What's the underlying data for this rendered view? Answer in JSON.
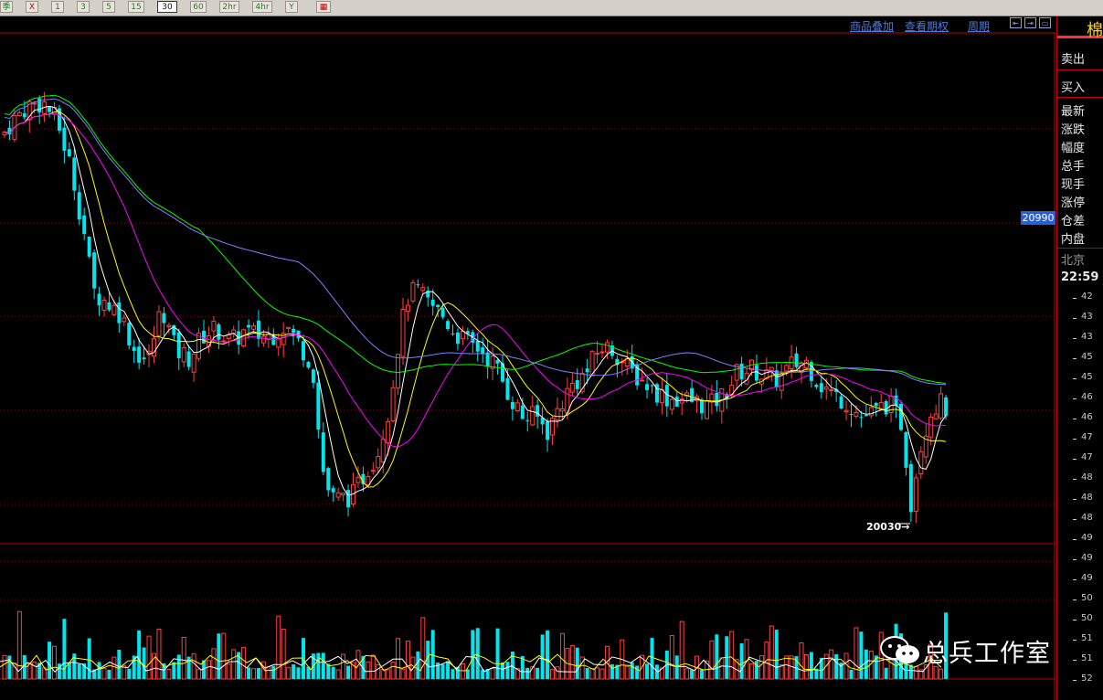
{
  "toolbar": {
    "buttons": [
      {
        "label": "季",
        "active": false
      },
      {
        "label": "X",
        "active": false
      },
      {
        "label": "1",
        "active": false
      },
      {
        "label": "3",
        "active": false
      },
      {
        "label": "5",
        "active": false
      },
      {
        "label": "15",
        "active": false
      },
      {
        "label": "30",
        "active": true
      },
      {
        "label": "60",
        "active": false
      },
      {
        "label": "2hr",
        "active": false
      },
      {
        "label": "4hr",
        "active": false
      },
      {
        "label": "Y",
        "active": false
      }
    ],
    "extra_icon": "calendar-icon"
  },
  "header_links": {
    "overlay": "商品叠加",
    "options": "查看期权",
    "period": "周期"
  },
  "panel": {
    "title": "棉",
    "sell": "卖出",
    "buy": "买入",
    "fields": [
      "最新",
      "涨跌",
      "幅度",
      "总手",
      "现手",
      "涨停",
      "仓差",
      "内盘"
    ],
    "city": "北京",
    "time": "22:59"
  },
  "price_tag": "20990",
  "low_annotation": "20030→",
  "watermark": "总兵工作室",
  "axis_labels": [
    "42",
    "43",
    "43",
    "45",
    "45",
    "46",
    "46",
    "47",
    "47",
    "48",
    "48",
    "48",
    "49",
    "49",
    "49",
    "50",
    "50",
    "51",
    "51",
    "52"
  ],
  "colors": {
    "up": "#ff4040",
    "down": "#00e5ee",
    "ma5": "#ffffff",
    "ma10": "#ffff00",
    "ma20": "#ff00ff",
    "ma40": "#00ff00",
    "ma60": "#8080ff",
    "grid": "#8b0000",
    "frame": "#c00000"
  },
  "chart_data": {
    "type": "candlestick",
    "title": "",
    "low_marker": 20030,
    "current_marker": 20990,
    "close_path": [
      [
        0,
        21040
      ],
      [
        12,
        21080
      ],
      [
        28,
        21120
      ],
      [
        45,
        21130
      ],
      [
        60,
        21080
      ],
      [
        75,
        20960
      ],
      [
        90,
        20780
      ],
      [
        100,
        20620
      ],
      [
        115,
        20590
      ],
      [
        130,
        20560
      ],
      [
        145,
        20460
      ],
      [
        160,
        20430
      ],
      [
        175,
        20580
      ],
      [
        190,
        20460
      ],
      [
        205,
        20440
      ],
      [
        220,
        20500
      ],
      [
        235,
        20520
      ],
      [
        250,
        20480
      ],
      [
        265,
        20510
      ],
      [
        280,
        20500
      ],
      [
        295,
        20500
      ],
      [
        310,
        20530
      ],
      [
        325,
        20480
      ],
      [
        340,
        20420
      ],
      [
        350,
        20150
      ],
      [
        360,
        20060
      ],
      [
        372,
        20060
      ],
      [
        385,
        20070
      ],
      [
        400,
        20140
      ],
      [
        412,
        20190
      ],
      [
        425,
        20320
      ],
      [
        435,
        20500
      ],
      [
        445,
        20610
      ],
      [
        455,
        20620
      ],
      [
        465,
        20590
      ],
      [
        480,
        20560
      ],
      [
        495,
        20510
      ],
      [
        510,
        20480
      ],
      [
        525,
        20460
      ],
      [
        540,
        20420
      ],
      [
        555,
        20340
      ],
      [
        570,
        20280
      ],
      [
        585,
        20280
      ],
      [
        598,
        20240
      ],
      [
        610,
        20310
      ],
      [
        625,
        20370
      ],
      [
        640,
        20400
      ],
      [
        655,
        20470
      ],
      [
        670,
        20460
      ],
      [
        685,
        20410
      ],
      [
        700,
        20380
      ],
      [
        715,
        20350
      ],
      [
        730,
        20330
      ],
      [
        745,
        20330
      ],
      [
        760,
        20320
      ],
      [
        775,
        20310
      ],
      [
        790,
        20340
      ],
      [
        805,
        20400
      ],
      [
        820,
        20410
      ],
      [
        835,
        20390
      ],
      [
        850,
        20380
      ],
      [
        865,
        20420
      ],
      [
        880,
        20430
      ],
      [
        895,
        20370
      ],
      [
        910,
        20340
      ],
      [
        925,
        20320
      ],
      [
        940,
        20280
      ],
      [
        955,
        20290
      ],
      [
        970,
        20320
      ],
      [
        985,
        20260
      ],
      [
        995,
        20050
      ],
      [
        1005,
        20200
      ],
      [
        1015,
        20290
      ],
      [
        1025,
        20320
      ],
      [
        1035,
        20300
      ]
    ],
    "moving_averages": [
      {
        "name": "MA5",
        "color": "#ffffff"
      },
      {
        "name": "MA10",
        "color": "#ffff00"
      },
      {
        "name": "MA20",
        "color": "#ff00ff"
      },
      {
        "name": "MA40",
        "color": "#00ff00"
      },
      {
        "name": "MA60",
        "color": "#8080ff"
      }
    ]
  }
}
